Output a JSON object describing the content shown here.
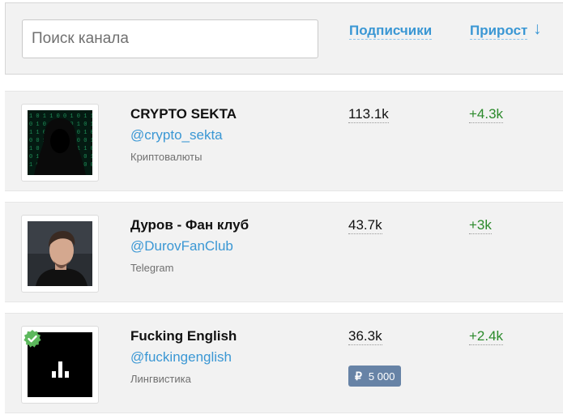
{
  "search": {
    "placeholder": "Поиск канала"
  },
  "columns": {
    "subscribers": "Подписчики",
    "growth": "Прирост",
    "sort_arrow": "↓"
  },
  "channels": [
    {
      "name": "CRYPTO SEKTA",
      "handle": "@crypto_sekta",
      "category": "Криптовалюты",
      "subscribers": "113.1k",
      "growth": "+4.3k",
      "verified": false,
      "avatar": "hooded-figure"
    },
    {
      "name": "Дуров - Фан клуб",
      "handle": "@DurovFanClub",
      "category": "Telegram",
      "subscribers": "43.7k",
      "growth": "+3k",
      "verified": false,
      "avatar": "portrait"
    },
    {
      "name": "Fucking English",
      "handle": "@fuckingenglish",
      "category": "Лингвистика",
      "subscribers": "36.3k",
      "growth": "+2.4k",
      "verified": true,
      "avatar": "bars-logo",
      "price": {
        "currency": "₽",
        "amount": "5 000"
      }
    }
  ],
  "colors": {
    "accent": "#3a97d4",
    "growth": "#2b8a2b",
    "price_badge": "#6783a6",
    "verified": "#5cb85c"
  }
}
